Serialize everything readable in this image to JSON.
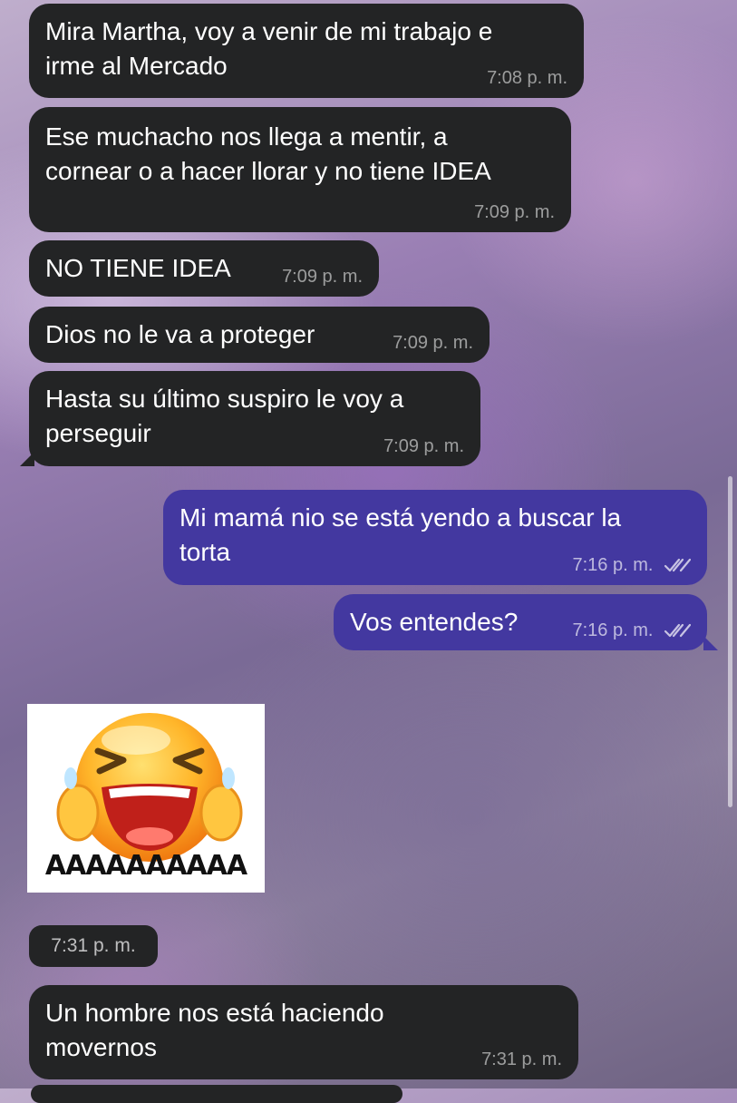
{
  "colors": {
    "incoming_bubble": "#232425",
    "outgoing_bubble": "#4338a0"
  },
  "messages": [
    {
      "text": "Mira Martha, voy a venir de mi trabajo e\nirme al Mercado",
      "time": "7:08 p. m."
    },
    {
      "text": "Ese muchacho nos llega a mentir, a\ncornear o a hacer llorar y no tiene IDEA",
      "time": "7:09 p. m."
    },
    {
      "text": "NO TIENE IDEA",
      "time": "7:09 p. m."
    },
    {
      "text": "Dios no le va a proteger",
      "time": "7:09 p. m."
    },
    {
      "text": "Hasta su último suspiro le voy a\nperseguir",
      "time": "7:09 p. m."
    },
    {
      "text": "Mi mamá nio se está yendo a buscar la\ntorta",
      "time": "7:16 p. m.",
      "status_icon": "double-check-icon"
    },
    {
      "text": "Vos entendes?",
      "time": "7:16 p. m.",
      "status_icon": "double-check-icon"
    },
    {
      "sticker_icon": "laughing-emoji-icon",
      "sticker_text": "AAAAAAAAAA",
      "time": "7:31 p. m."
    },
    {
      "text": "Un hombre nos está haciendo\nmovernos",
      "time": "7:31 p. m."
    }
  ]
}
